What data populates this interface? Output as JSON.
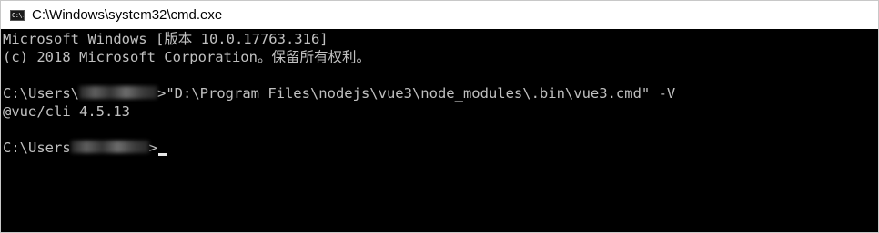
{
  "window": {
    "title": "C:\\Windows\\system32\\cmd.exe",
    "icon": "cmd-icon",
    "icon_text": "C:\\."
  },
  "console": {
    "lines": [
      "Microsoft Windows [版本 10.0.17763.316]",
      "(c) 2018 Microsoft Corporation。保留所有权利。",
      "",
      {
        "prefix": "C:\\Users\\",
        "suffix": ">\"D:\\Program Files\\nodejs\\vue3\\node_modules\\.bin\\vue3.cmd\" -V"
      },
      "@vue/cli 4.5.13",
      "",
      {
        "prefix": "C:\\Users",
        "suffix": ">"
      }
    ]
  },
  "colors": {
    "console_bg": "#000000",
    "console_fg": "#c0c0c0",
    "titlebar_bg": "#ffffff"
  }
}
